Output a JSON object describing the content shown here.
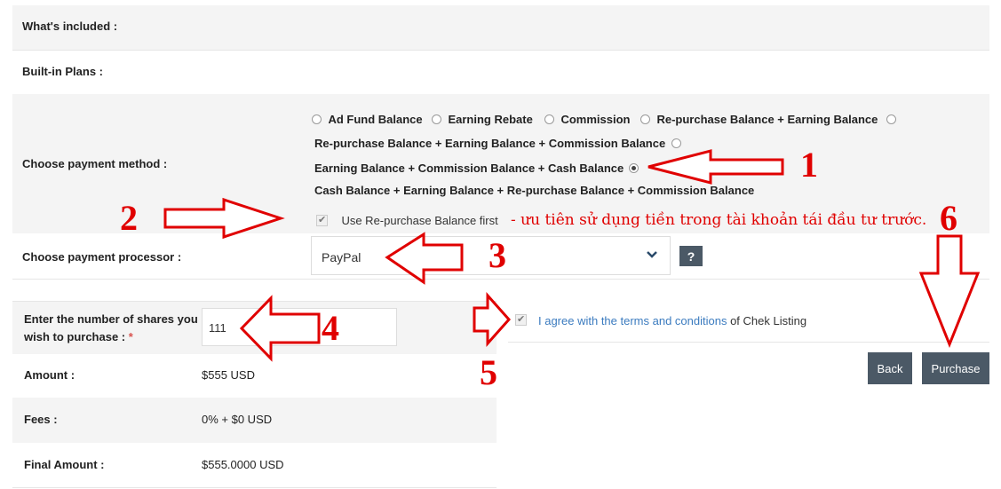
{
  "rows": {
    "whats_included": "What's included :",
    "built_in_plans": "Built-in Plans :",
    "payment_method": "Choose payment method :",
    "payment_processor": "Choose payment processor :"
  },
  "payment_methods": [
    {
      "label": "Ad Fund Balance",
      "selected": false
    },
    {
      "label": "Earning Rebate",
      "selected": false
    },
    {
      "label": "Commission",
      "selected": false
    },
    {
      "label": "Re-purchase Balance + Earning Balance",
      "selected": false
    },
    {
      "label": "Re-purchase Balance + Earning Balance + Commission Balance",
      "selected": false
    },
    {
      "label": "Earning Balance + Commission Balance + Cash Balance",
      "selected": true
    },
    {
      "label": "Cash Balance + Earning Balance + Re-purchase Balance + Commission Balance",
      "selected": false
    }
  ],
  "repurchase_first": {
    "label": "Use Re-purchase Balance first",
    "checked": true
  },
  "annotation_text": "- ưu tiên sử dụng tiền trong tài khoản tái đầu tư trước.",
  "processor": {
    "value": "PayPal",
    "help": "?"
  },
  "shares": {
    "label": "Enter the number of shares you wish to purchase :",
    "required_mark": "*",
    "value": "111"
  },
  "terms": {
    "link_text": "I agree with the terms and conditions",
    "suffix": " of Chek Listing",
    "checked": true
  },
  "summary": {
    "amount_label": "Amount :",
    "amount_value": "$555 USD",
    "fees_label": "Fees :",
    "fees_value": "0% + $0 USD",
    "final_label": "Final Amount :",
    "final_value": "$555.0000 USD"
  },
  "buttons": {
    "back": "Back",
    "purchase": "Purchase"
  },
  "step_numbers": [
    "1",
    "2",
    "3",
    "4",
    "5",
    "6"
  ],
  "colors": {
    "annotation": "#e00000",
    "button": "#4b5966",
    "link": "#3b7bbf"
  }
}
